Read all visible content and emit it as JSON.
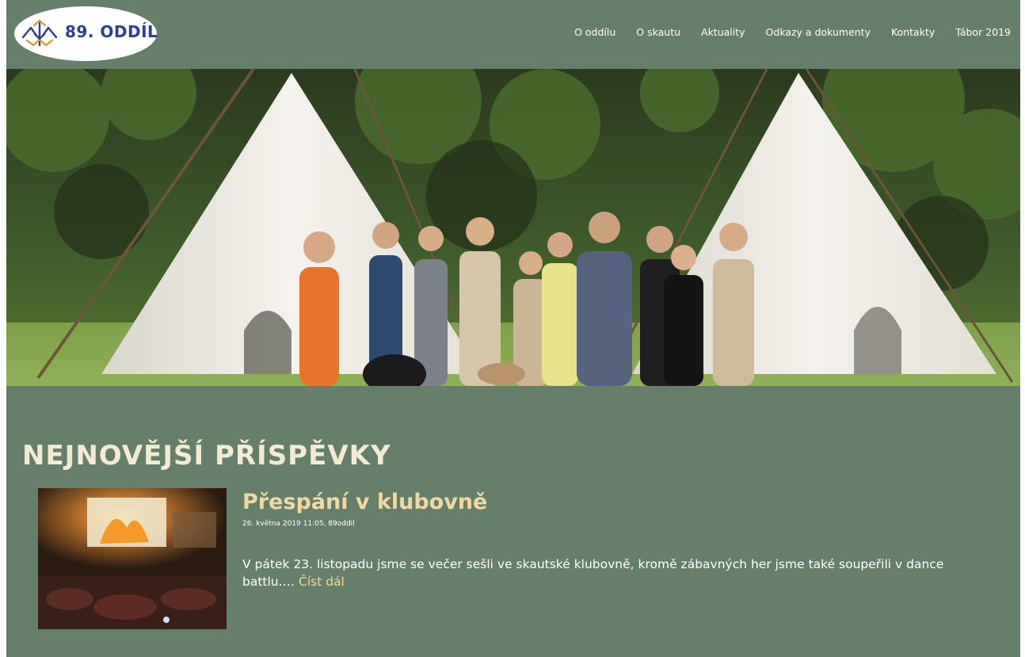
{
  "brand": {
    "logo_text": "89. ODDÍL",
    "logo_icon": "scout-lily-icon",
    "logo_colors": [
      "#2d3f8e",
      "#e0a12b"
    ]
  },
  "nav": {
    "items": [
      {
        "label": "O oddílu"
      },
      {
        "label": "O skautu"
      },
      {
        "label": "Aktuality"
      },
      {
        "label": "Odkazy a dokumenty"
      },
      {
        "label": "Kontakty"
      },
      {
        "label": "Tábor 2019"
      }
    ]
  },
  "hero": {
    "image": "group-photo-teepees"
  },
  "main": {
    "section_title": "NEJNOVĚJŠÍ PŘÍSPĚVKY",
    "posts": [
      {
        "title": "Přespání v klubovně",
        "meta": "26. května 2019 11:05, 89oddil",
        "excerpt": "V pátek 23. listopadu jsme se večer sešli ve skautské klubovně, kromě zábavných her jsme také soupeřili v dance battlu.…",
        "read_more": "Číst dál",
        "thumbnail": "clubroom-projection-photo"
      }
    ]
  },
  "colors": {
    "background": "#667f6b",
    "title_cream": "#f3ead2",
    "accent_gold": "#f0d8a0",
    "text_white": "#ffffff"
  }
}
